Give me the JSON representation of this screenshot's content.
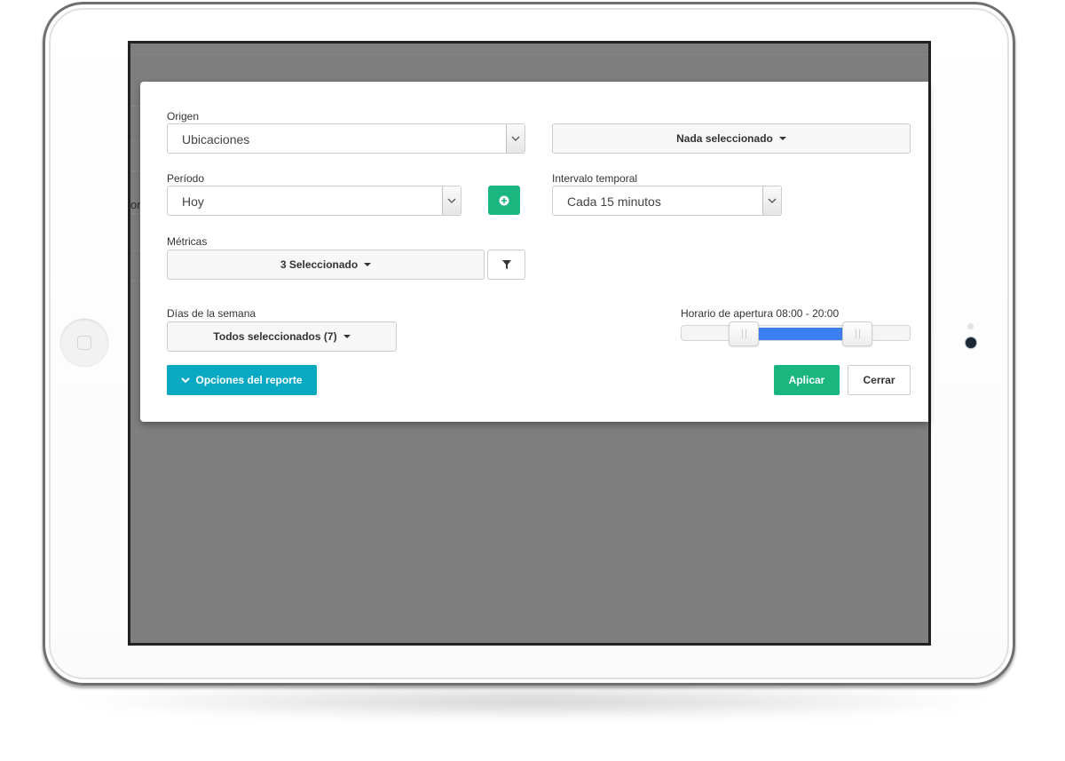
{
  "form": {
    "origen": {
      "label": "Origen",
      "value": "Ubicaciones"
    },
    "selection": {
      "label": "Nada seleccionado"
    },
    "periodo": {
      "label": "Período",
      "value": "Hoy"
    },
    "intervalo": {
      "label": "Intervalo temporal",
      "value": "Cada 15 minutos"
    },
    "metricas": {
      "label": "Métricas",
      "value": "3 Seleccionado"
    },
    "dias": {
      "label": "Días de la semana",
      "value": "Todos seleccionados (7)"
    },
    "horario": {
      "label": "Horario de apertura 08:00 - 20:00",
      "range": [
        8,
        20
      ],
      "scale": [
        0,
        24
      ]
    }
  },
  "buttons": {
    "opciones": "Opciones del reporte",
    "aplicar": "Aplicar",
    "cerrar": "Cerrar"
  },
  "background": {
    "fragment_text": "on"
  },
  "colors": {
    "green": "#1ab680",
    "teal": "#09a9c4",
    "slider_blue": "#3d7ff0",
    "overlay": "#7f7f7f"
  },
  "icons": [
    "chevron-down-icon",
    "caret-down-icon",
    "plus-circle-icon",
    "filter-icon",
    "home-square-icon",
    "camera-icon"
  ]
}
